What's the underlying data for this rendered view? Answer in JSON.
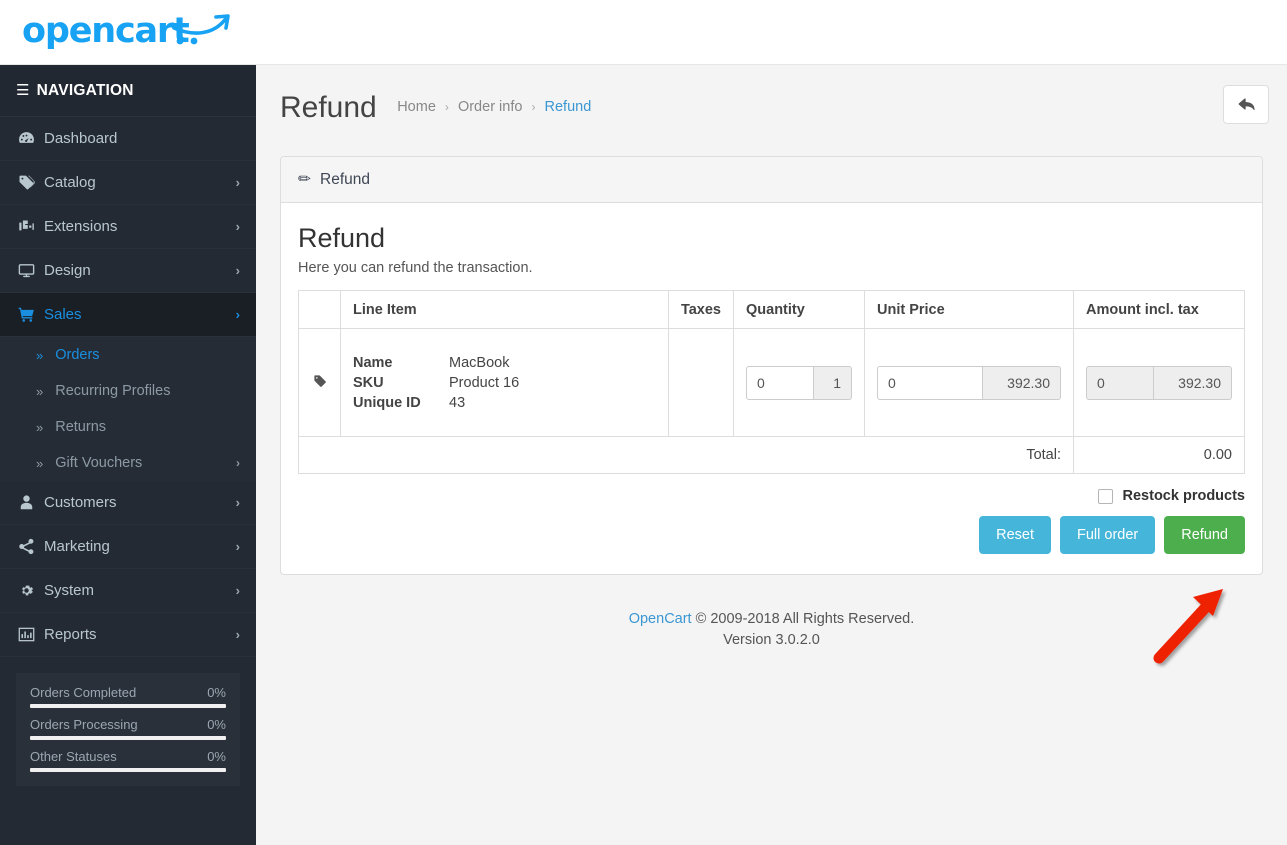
{
  "brand": {
    "logo_text": "opencart",
    "logo_color": "#17a2f3"
  },
  "sidebar": {
    "nav_header": "NAVIGATION",
    "burger_icon": "hamburger-icon",
    "items": [
      {
        "label": "Dashboard",
        "icon": "dashboard-icon",
        "caret": "",
        "active": false
      },
      {
        "label": "Catalog",
        "icon": "tag-icon",
        "caret": "›",
        "active": false
      },
      {
        "label": "Extensions",
        "icon": "puzzle-icon",
        "caret": "›",
        "active": false
      },
      {
        "label": "Design",
        "icon": "monitor-icon",
        "caret": "›",
        "active": false
      },
      {
        "label": "Sales",
        "icon": "cart-icon",
        "caret": "›",
        "active": true
      }
    ],
    "sub_items": [
      {
        "label": "Orders",
        "chev": "»",
        "caret": "",
        "active": true
      },
      {
        "label": "Recurring Profiles",
        "chev": "»",
        "caret": "",
        "active": false
      },
      {
        "label": "Returns",
        "chev": "»",
        "caret": "",
        "active": false
      },
      {
        "label": "Gift Vouchers",
        "chev": "»",
        "caret": "›",
        "active": false
      }
    ],
    "items_after": [
      {
        "label": "Customers",
        "icon": "user-icon",
        "caret": "›",
        "active": false
      },
      {
        "label": "Marketing",
        "icon": "share-icon",
        "caret": "›",
        "active": false
      },
      {
        "label": "System",
        "icon": "gear-icon",
        "caret": "›",
        "active": false
      },
      {
        "label": "Reports",
        "icon": "bar-chart-icon",
        "caret": "›",
        "active": false
      }
    ],
    "stats": [
      {
        "label": "Orders Completed",
        "percent": "0%",
        "value": 0
      },
      {
        "label": "Orders Processing",
        "percent": "0%",
        "value": 0
      },
      {
        "label": "Other Statuses",
        "percent": "0%",
        "value": 0
      }
    ]
  },
  "header": {
    "title": "Refund",
    "breadcrumb": [
      {
        "label": "Home",
        "current": false
      },
      {
        "label": "Order info",
        "current": false
      },
      {
        "label": "Refund",
        "current": true
      }
    ],
    "separator": "›",
    "back_button_icon": "back-arrow-icon"
  },
  "panel": {
    "head_title": "Refund",
    "head_icon": "pencil-icon",
    "heading": "Refund",
    "description": "Here you can refund the transaction."
  },
  "table": {
    "columns": [
      "",
      "Line Item",
      "Taxes",
      "Quantity",
      "Unit Price",
      "Amount incl. tax"
    ],
    "row": {
      "row_icon": "tag-icon",
      "fields": [
        {
          "key": "Name",
          "value": "MacBook"
        },
        {
          "key": "SKU",
          "value": "Product 16"
        },
        {
          "key": "Unique ID",
          "value": "43"
        }
      ],
      "taxes": "",
      "quantity": {
        "input_value": "0",
        "addon_value": "1",
        "disabled": false
      },
      "unit_price": {
        "input_value": "0",
        "addon_value": "392.30",
        "disabled": false
      },
      "amount": {
        "input_value": "0",
        "addon_value": "392.30",
        "disabled": true
      }
    },
    "total_label": "Total:",
    "total_value": "0.00"
  },
  "actions": {
    "restock_label": "Restock products",
    "restock_checked": false,
    "reset_label": "Reset",
    "full_order_label": "Full order",
    "refund_label": "Refund",
    "info_color": "#45b6da",
    "success_color": "#4cae4c"
  },
  "footer": {
    "link_text": "OpenCart",
    "copyright": " © 2009-2018 All Rights Reserved.",
    "version": "Version 3.0.2.0"
  },
  "annotation": {
    "arrow_color": "#ee2200",
    "points_to": "refund-button"
  }
}
